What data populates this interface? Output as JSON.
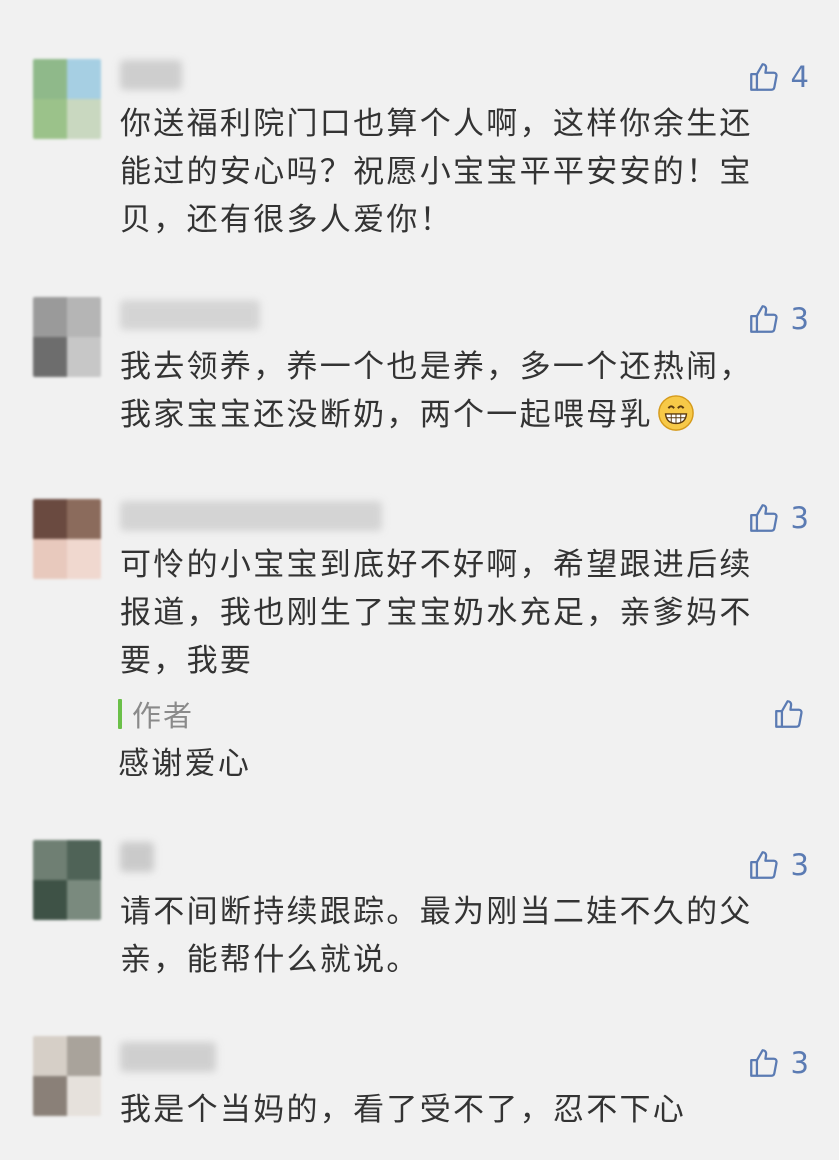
{
  "comments": [
    {
      "likes": "4",
      "text": "你送福利院门口也算个人啊，这样你余生还\n能过的安心吗？祝愿小宝宝平平安安的！宝\n贝，还有很多人爱你！"
    },
    {
      "likes": "3",
      "text": "我去领养，养一个也是养，多一个还热闹，\n我家宝宝还没断奶，两个一起喂母乳",
      "emoji": "grinning-face-emoji"
    },
    {
      "likes": "3",
      "text": "可怜的小宝宝到底好不好啊，希望跟进后续\n报道，我也刚生了宝宝奶水充足，亲爹妈不\n要，我要",
      "reply": {
        "label": "作者",
        "text": "感谢爱心"
      }
    },
    {
      "likes": "3",
      "text": "请不间断持续跟踪。最为刚当二娃不久的父\n亲，能帮什么就说。"
    },
    {
      "likes": "3",
      "text": "我是个当妈的，看了受不了，忍不下心"
    }
  ],
  "colors": {
    "background": "#f1f1f1",
    "like_blue": "#5b7bb3",
    "author_accent": "#6bc049",
    "text": "#333333"
  },
  "icons": {
    "like": "thumbs-up-icon"
  }
}
